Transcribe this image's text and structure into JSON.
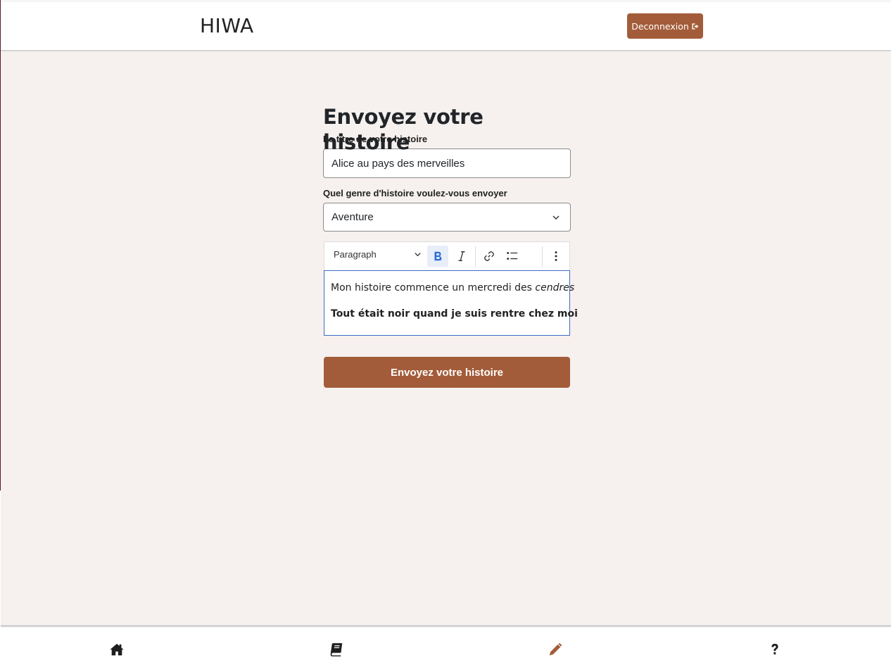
{
  "header": {
    "brand": "HIWA",
    "logout_label": "Deconnexion",
    "logout_icon": "sign-out-icon"
  },
  "form": {
    "title": "Envoyez votre histoire",
    "story_title_label": "Le titre de votre histoire",
    "story_title_value": "Alice au pays des merveilles",
    "genre_label": "Quel genre d'histoire voulez-vous envoyer",
    "genre_selected": "Aventure",
    "editor": {
      "block_type": "Paragraph",
      "bold_active": true,
      "toolbar_icons": [
        "chevron-down-icon",
        "bold-icon",
        "italic-icon",
        "link-icon",
        "bulleted-list-icon",
        "more-options-icon"
      ],
      "line1_text": "Mon histoire commence un mercredi des ",
      "line1_italic": "cendres",
      "line2_text": "Tout était noir quand je suis rentre chez moi"
    },
    "submit_label": "Envoyez votre histoire"
  },
  "bottom_nav": {
    "items": [
      "home-icon",
      "book-icon",
      "pencil-icon",
      "question-icon"
    ],
    "active": "pencil-icon"
  },
  "colors": {
    "accent": "#a35c39",
    "background": "#f6f1ee",
    "editor_focus": "#3c6bc9",
    "bold_active": "#2f6fd6"
  }
}
